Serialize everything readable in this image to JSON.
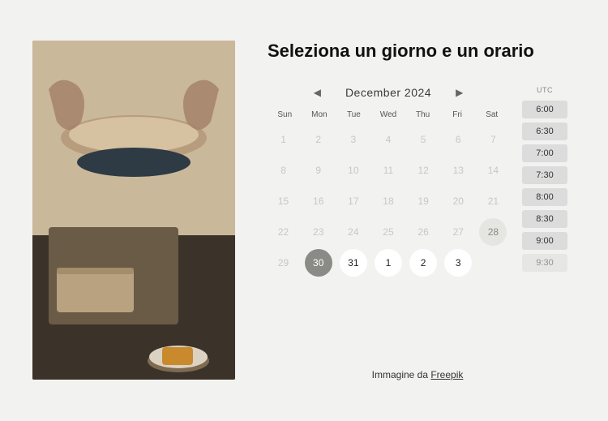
{
  "title": "Seleziona un giorno e un orario",
  "image_alt": "pottery-image",
  "credit": {
    "prefix": "Immagine da ",
    "link_text": "Freepik"
  },
  "calendar": {
    "month_label": "December  2024",
    "timezone": "UTC",
    "dow": [
      "Sun",
      "Mon",
      "Tue",
      "Wed",
      "Thu",
      "Fri",
      "Sat"
    ],
    "days": [
      {
        "n": 1,
        "state": "disabled"
      },
      {
        "n": 2,
        "state": "disabled"
      },
      {
        "n": 3,
        "state": "disabled"
      },
      {
        "n": 4,
        "state": "disabled"
      },
      {
        "n": 5,
        "state": "disabled"
      },
      {
        "n": 6,
        "state": "disabled"
      },
      {
        "n": 7,
        "state": "disabled"
      },
      {
        "n": 8,
        "state": "disabled"
      },
      {
        "n": 9,
        "state": "disabled"
      },
      {
        "n": 10,
        "state": "disabled"
      },
      {
        "n": 11,
        "state": "disabled"
      },
      {
        "n": 12,
        "state": "disabled"
      },
      {
        "n": 13,
        "state": "disabled"
      },
      {
        "n": 14,
        "state": "disabled"
      },
      {
        "n": 15,
        "state": "disabled"
      },
      {
        "n": 16,
        "state": "disabled"
      },
      {
        "n": 17,
        "state": "disabled"
      },
      {
        "n": 18,
        "state": "disabled"
      },
      {
        "n": 19,
        "state": "disabled"
      },
      {
        "n": 20,
        "state": "disabled"
      },
      {
        "n": 21,
        "state": "disabled"
      },
      {
        "n": 22,
        "state": "disabled"
      },
      {
        "n": 23,
        "state": "disabled"
      },
      {
        "n": 24,
        "state": "disabled"
      },
      {
        "n": 25,
        "state": "disabled"
      },
      {
        "n": 26,
        "state": "disabled"
      },
      {
        "n": 27,
        "state": "disabled"
      },
      {
        "n": 28,
        "state": "today"
      },
      {
        "n": 29,
        "state": "disabled"
      },
      {
        "n": 30,
        "state": "selected"
      },
      {
        "n": 31,
        "state": "avail"
      },
      {
        "n": 1,
        "state": "avail"
      },
      {
        "n": 2,
        "state": "avail"
      },
      {
        "n": 3,
        "state": "avail"
      }
    ],
    "slots": [
      "6:00",
      "6:30",
      "7:00",
      "7:30",
      "8:00",
      "8:30",
      "9:00",
      "9:30"
    ]
  }
}
